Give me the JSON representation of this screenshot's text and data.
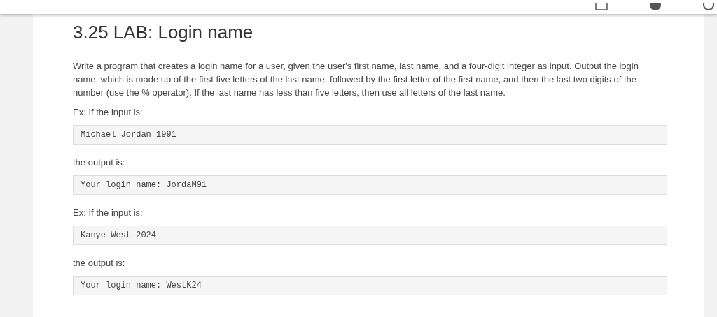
{
  "title": "3.25 LAB: Login name",
  "blocks": [
    {
      "kind": "text",
      "text": "Write a program that creates a login name for a user, given the user's first name, last name, and a four-digit integer as input. Output the login name, which is made up of the first five letters of the last name, followed by the first letter of the first name, and then the last two digits of the number (use the % operator). If the last name has less than five letters, then use all letters of the last name."
    },
    {
      "kind": "text",
      "text": "Ex: If the input is:"
    },
    {
      "kind": "code",
      "text": "Michael Jordan 1991"
    },
    {
      "kind": "text",
      "text": "the output is:"
    },
    {
      "kind": "code",
      "text": "Your login name: JordaM91"
    },
    {
      "kind": "text",
      "text": "Ex: If the input is:"
    },
    {
      "kind": "code",
      "text": "Kanye West 2024"
    },
    {
      "kind": "text",
      "text": "the output is:"
    },
    {
      "kind": "code",
      "text": "Your login name: WestK24"
    }
  ]
}
